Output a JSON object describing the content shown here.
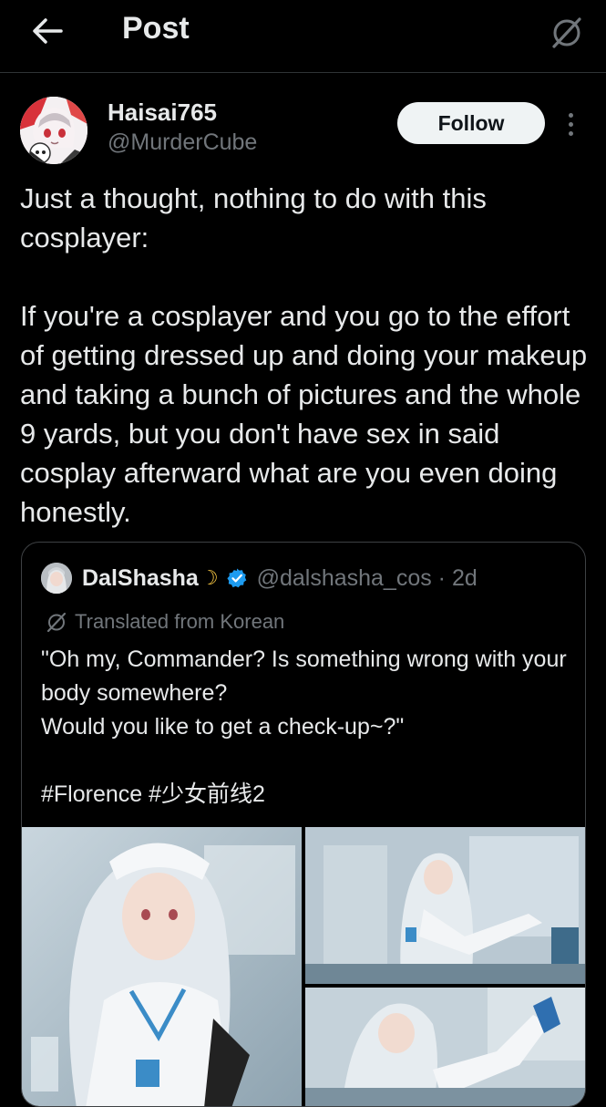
{
  "header": {
    "title": "Post"
  },
  "post": {
    "author_name": "Haisai765",
    "author_handle": "@MurderCube",
    "follow_label": "Follow",
    "text": "Just a thought, nothing to do with this cosplayer:\n\nIf you're a cosplayer and you go to the effort of getting dressed up and doing your makeup and taking a bunch of pictures and the whole 9 yards, but you don't have sex in said cosplay afterward what are you even doing honestly."
  },
  "quote": {
    "author_name": "DalShasha",
    "moon": "☽",
    "handle_time": "@dalshasha_cos · 2d",
    "translated_label": "Translated from Korean",
    "text": "\"Oh my, Commander? Is something wrong with your body somewhere?\nWould you like to get a check-up~?\"\n\n#Florence  #少女前线2"
  },
  "icons": {
    "back": "arrow-left-icon",
    "grok": "grok-icon",
    "more": "more-vertical-icon",
    "verified": "verified-badge-icon",
    "translate": "translate-icon"
  },
  "colors": {
    "background": "#000000",
    "text_primary": "#e7e9ea",
    "text_secondary": "#71767b",
    "border": "#2f3336",
    "verified_blue": "#1d9bf0",
    "follow_bg": "#eff3f4"
  }
}
